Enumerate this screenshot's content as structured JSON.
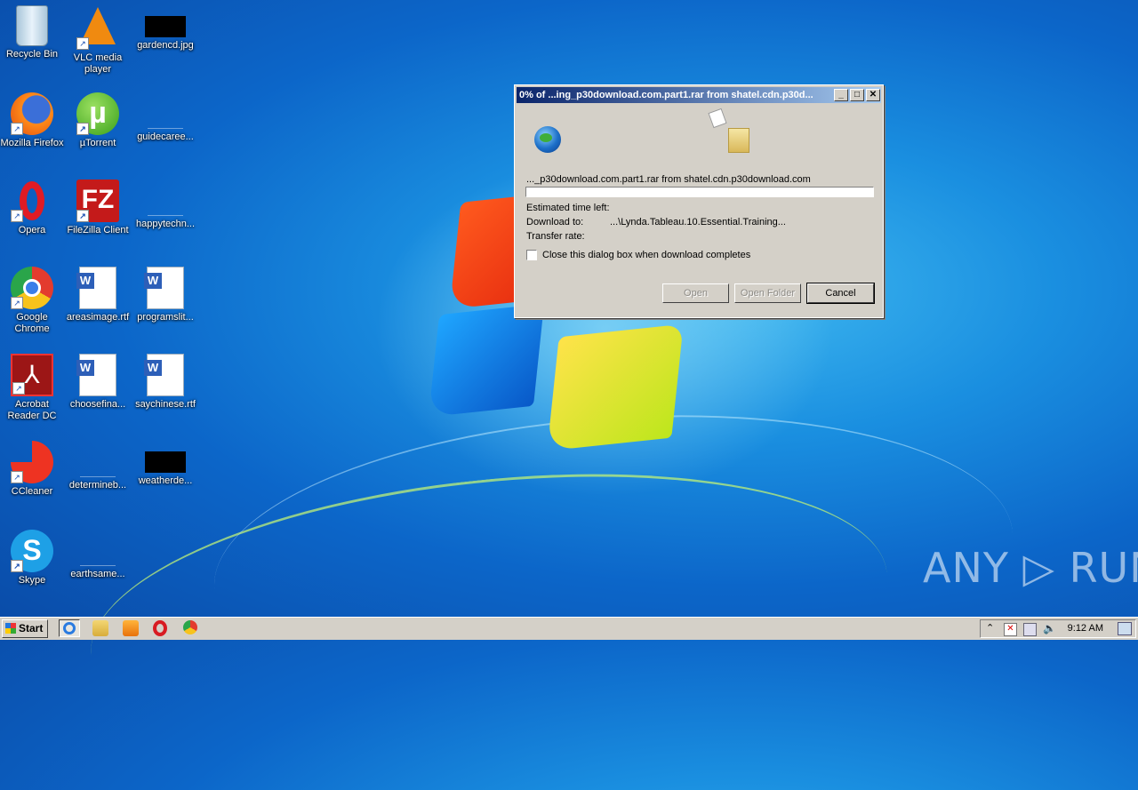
{
  "desktop": {
    "icons": [
      {
        "label": "Recycle Bin"
      },
      {
        "label": "VLC media player"
      },
      {
        "label": "gardencd.jpg"
      },
      {
        "label": "Mozilla Firefox"
      },
      {
        "label": "µTorrent"
      },
      {
        "label": "guidecaree..."
      },
      {
        "label": "Opera"
      },
      {
        "label": "FileZilla Client"
      },
      {
        "label": "happytechn..."
      },
      {
        "label": "Google Chrome"
      },
      {
        "label": "areasimage.rtf"
      },
      {
        "label": "programslit..."
      },
      {
        "label": "Acrobat Reader DC"
      },
      {
        "label": "choosefina..."
      },
      {
        "label": "saychinese.rtf"
      },
      {
        "label": "CCleaner"
      },
      {
        "label": "determineb..."
      },
      {
        "label": "weatherde..."
      },
      {
        "label": "Skype"
      },
      {
        "label": "earthsame..."
      }
    ]
  },
  "dialog": {
    "title": "0% of ...ing_p30download.com.part1.rar from shatel.cdn.p30d...",
    "source_line": "..._p30download.com.part1.rar from shatel.cdn.p30download.com",
    "progress_fraction": 0,
    "estimated_label": "Estimated time left:",
    "download_to_label": "Download to:",
    "download_to_value": "...\\Lynda.Tableau.10.Essential.Training...",
    "transfer_rate_label": "Transfer rate:",
    "close_checkbox_label": "Close this dialog box when download completes",
    "close_checkbox_checked": false,
    "buttons": {
      "open": "Open",
      "open_folder": "Open Folder",
      "cancel": "Cancel"
    },
    "controls": {
      "minimize": "_",
      "maximize": "□",
      "close": "✕"
    }
  },
  "watermark": "ANY ▷ RUN",
  "taskbar": {
    "start_label": "Start",
    "clock": "9:12 AM",
    "pinned": [
      "internet-explorer-icon",
      "explorer-icon",
      "media-player-icon",
      "opera-icon",
      "chrome-icon"
    ]
  }
}
